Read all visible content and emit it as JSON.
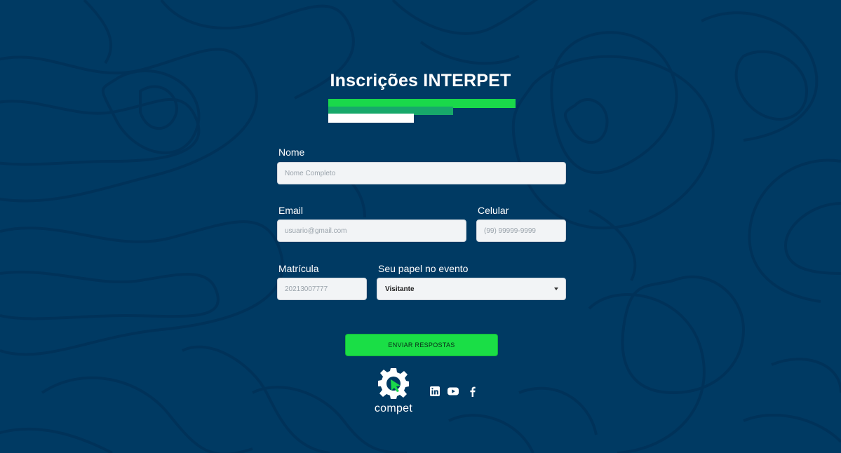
{
  "header": {
    "title": "Inscrições INTERPET"
  },
  "form": {
    "nome": {
      "label": "Nome",
      "placeholder": "Nome Completo"
    },
    "email": {
      "label": "Email",
      "placeholder": "usuario@gmail.com"
    },
    "celular": {
      "label": "Celular",
      "placeholder": "(99) 99999-9999"
    },
    "matricula": {
      "label": "Matrícula",
      "placeholder": "20213007777"
    },
    "papel": {
      "label": "Seu papel no evento",
      "selected": "Visitante"
    },
    "submit_label": "ENVIAR RESPOSTAS"
  },
  "footer": {
    "logo_text": "compet",
    "social": [
      {
        "icon": "linkedin-icon"
      },
      {
        "icon": "youtube-icon"
      },
      {
        "icon": "facebook-icon"
      }
    ]
  },
  "colors": {
    "background": "#003a63",
    "accent_green": "#1ad84a",
    "accent_teal": "#17a86a",
    "field_bg": "#f2f4f6"
  }
}
